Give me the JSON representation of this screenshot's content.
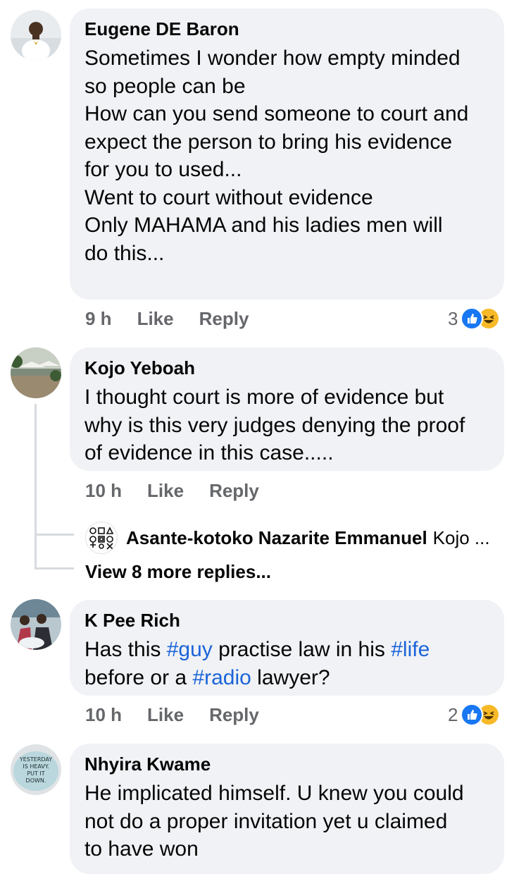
{
  "comments": [
    {
      "author": "Eugene DE Baron",
      "lines": [
        "Sometimes I wonder how empty minded",
        "so people can be",
        "How can you send someone to court and",
        "expect the person to bring his evidence",
        "for you to used...",
        "Went to court without evidence",
        "Only MAHAMA and his ladies men will",
        "do this..."
      ],
      "time": "9 h",
      "like": "Like",
      "reply": "Reply",
      "reaction_count": "3"
    },
    {
      "author": "Kojo Yeboah",
      "lines": [
        "I thought court is more of evidence but",
        "why is this very judges denying the proof",
        "of evidence in this case....."
      ],
      "time": "10 h",
      "like": "Like",
      "reply": "Reply",
      "reply_preview": {
        "author": "Asante-kotoko Nazarite Emmanuel",
        "text": "Kojo ..."
      },
      "view_more": "View 8 more replies..."
    },
    {
      "author": "K Pee Rich",
      "line1": {
        "a": "Has this ",
        "tag1": "#guy",
        "b": " practise law in his ",
        "tag2": "#life"
      },
      "line2": {
        "a": "before or a ",
        "tag": "#radio",
        "b": " lawyer?"
      },
      "time": "10 h",
      "like": "Like",
      "reply": "Reply",
      "reaction_count": "2"
    },
    {
      "author": "Nhyira Kwame",
      "lines": [
        "He implicated himself. U knew you could",
        "not do a proper invitation yet u claimed",
        "to have won"
      ],
      "avatar_text": [
        "YESTERDAY",
        "IS HEAVY.",
        "PUT IT",
        "DOWN."
      ]
    }
  ],
  "icons": {
    "like_reaction": "like-icon",
    "haha_reaction": "haha-icon"
  },
  "colors": {
    "bubble": "#f0f2f5",
    "hashtag": "#1b64d8",
    "meta": "#65676b",
    "like_blue": "#1877f2",
    "haha_yellow": "#f7b928"
  }
}
